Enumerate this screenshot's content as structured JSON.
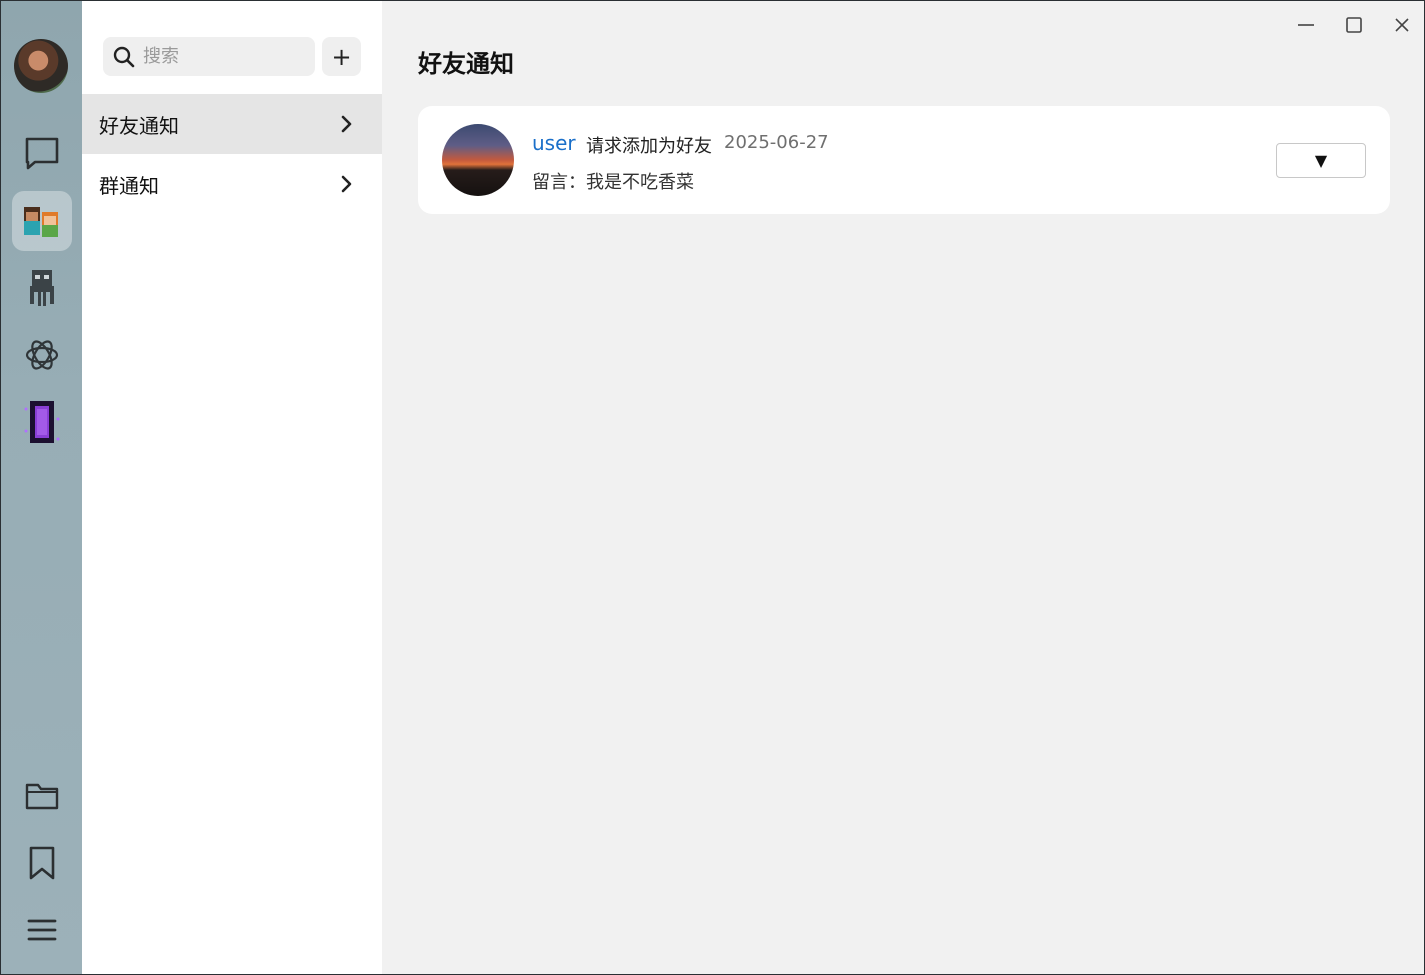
{
  "rail": {
    "items": [
      {
        "name": "chat-icon"
      },
      {
        "name": "contacts-icon",
        "active": true
      },
      {
        "name": "robot-icon"
      },
      {
        "name": "ai-icon"
      },
      {
        "name": "portal-icon"
      }
    ],
    "bottom": [
      {
        "name": "folder-icon"
      },
      {
        "name": "bookmark-icon"
      },
      {
        "name": "menu-icon"
      }
    ]
  },
  "sidebar": {
    "search_placeholder": "搜索",
    "add_label": "+",
    "items": [
      {
        "label": "好友通知",
        "active": true
      },
      {
        "label": "群通知",
        "active": false
      }
    ]
  },
  "main": {
    "title": "好友通知",
    "request": {
      "user": "user",
      "text": "请求添加为好友",
      "date": "2025-06-27",
      "message": "留言：我是不吃香菜",
      "action_label": "▼"
    }
  },
  "window_controls": {
    "minimize": "minimize-icon",
    "maximize": "maximize-icon",
    "close": "close-icon"
  },
  "colors": {
    "accent_link": "#1a6fc9",
    "rail_bg": "#97adb5",
    "panel_bg": "#ffffff",
    "main_bg": "#f1f1f1",
    "active_item_bg": "#e5e5e5"
  }
}
